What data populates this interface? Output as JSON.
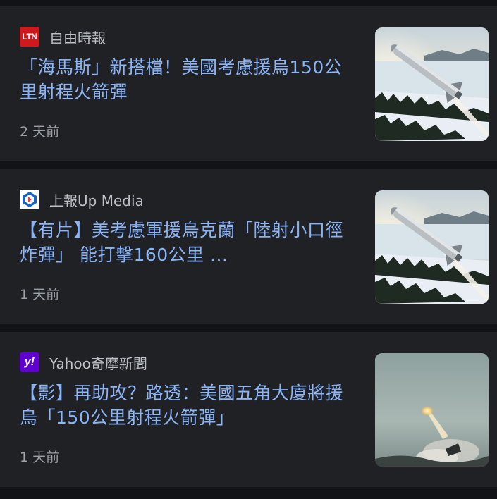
{
  "articles": [
    {
      "source": "自由時報",
      "logo_text": "LTN",
      "logo_color": "#d0191f",
      "headline": "「海馬斯」新搭檔！美國考慮援烏150公里射程火箭彈",
      "time": "2 天前",
      "thumbnail": "missile-over-snowy-landscape"
    },
    {
      "source": "上報Up Media",
      "logo_text": "",
      "logo_color": "#1565c0",
      "headline": "【有片】美考慮軍援烏克蘭「陸射小口徑炸彈」 能打擊160公里 ...",
      "time": "1 天前",
      "thumbnail": "missile-over-snowy-landscape"
    },
    {
      "source": "Yahoo奇摩新聞",
      "logo_text": "y!",
      "logo_color": "#6001d2",
      "headline": "【影】再助攻？路透：美國五角大廈將援烏「150公里射程火箭彈」",
      "time": "1 天前",
      "thumbnail": "rocket-launch"
    }
  ]
}
